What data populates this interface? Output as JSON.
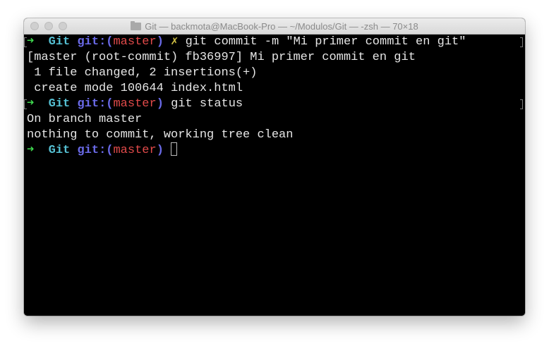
{
  "window": {
    "title": "Git — backmota@MacBook-Pro — ~/Modulos/Git — -zsh — 70×18"
  },
  "prompt": {
    "arrow": "➜",
    "dir": "Git",
    "git_prefix": "git:(",
    "branch": "master",
    "git_suffix": ")",
    "dirty_marker": "✗"
  },
  "lines": {
    "cmd1": "git commit -m \"Mi primer commit en git\"",
    "out1": "[master (root-commit) fb36997] Mi primer commit en git",
    "out2": " 1 file changed, 2 insertions(+)",
    "out3": " create mode 100644 index.html",
    "cmd2": "git status",
    "out4": "On branch master",
    "out5": "nothing to commit, working tree clean"
  },
  "colors": {
    "background": "#000000",
    "text": "#e6e6e6",
    "arrow": "#3fd94f",
    "dir": "#55c0d3",
    "git_label": "#6a6ae8",
    "branch": "#e14a4a",
    "dirty_marker": "#d1c043"
  }
}
